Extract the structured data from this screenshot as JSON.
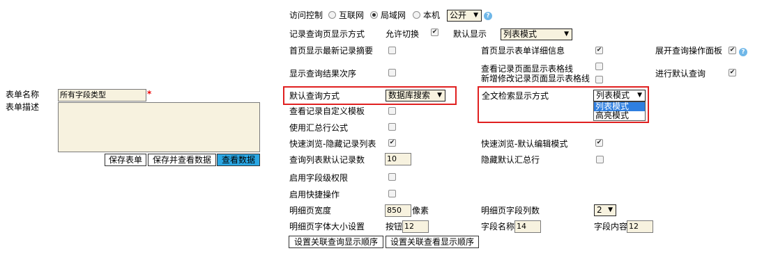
{
  "left": {
    "form_name_label": "表单名称",
    "form_name_value": "所有字段类型",
    "required_mark": "*",
    "form_desc_label": "表单描述",
    "form_desc_value": "",
    "btn_save": "保存表单",
    "btn_save_view": "保存并查看数据",
    "btn_view": "查看数据"
  },
  "access": {
    "label": "访问控制",
    "options": [
      "互联网",
      "局域网",
      "本机"
    ],
    "selected": "局域网",
    "visibility": "公开"
  },
  "rows": {
    "record_query_display": "记录查询页显示方式",
    "allow_switch": "允许切换",
    "default_display": "默认显示",
    "default_display_value": "列表模式",
    "home_latest": "首页显示最新记录摘要",
    "home_detail": "首页显示表单详细信息",
    "expand_panel": "展开查询操作面板",
    "show_order": "显示查询结果次序",
    "view_table_lines": "查看记录页面显示表格线",
    "add_edit_lines": "新增修改记录页面显示表格线",
    "default_query_run": "进行默认查询",
    "default_query_mode": "默认查询方式",
    "default_query_value": "数据库搜索",
    "fulltext_mode": "全文检索显示方式",
    "fulltext_value": "列表模式",
    "fulltext_options": [
      "列表模式",
      "高亮模式"
    ],
    "custom_template": "查看记录自定义模板",
    "summary_formula": "使用汇总行公式",
    "quick_hide_list": "快速浏览-隐藏记录列表",
    "quick_default_edit": "快速浏览-默认编辑模式",
    "list_default_count": "查询列表默认记录数",
    "list_default_count_value": "10",
    "hide_summary": "隐藏默认汇总行",
    "field_permission": "启用字段级权限",
    "quick_ops": "启用快捷操作",
    "detail_width": "明细页宽度",
    "detail_width_value": "850",
    "detail_width_unit": "像素",
    "detail_cols": "明细页字段列数",
    "detail_cols_value": "2",
    "font_size": "明细页字体大小设置",
    "btn_size_label": "按钮",
    "btn_size_value": "12",
    "field_name_label": "字段名称",
    "field_name_value": "14",
    "field_content_label": "字段内容",
    "field_content_value": "12",
    "btn_assoc_query": "设置关联查询显示顺序",
    "btn_assoc_view": "设置关联查看显示顺序"
  },
  "checks": {
    "allow_switch": true,
    "home_latest": false,
    "home_detail": true,
    "expand_panel": true,
    "show_order": false,
    "view_table_lines": false,
    "add_edit_lines": false,
    "default_query_run": true,
    "custom_template": false,
    "summary_formula": false,
    "quick_hide_list": true,
    "quick_default_edit": true,
    "hide_summary": false,
    "field_permission": false,
    "quick_ops": false
  },
  "colors": {
    "highlight_box": "#e02020",
    "input_bg": "#f7f2df",
    "view_button": "#2aa7e4"
  }
}
